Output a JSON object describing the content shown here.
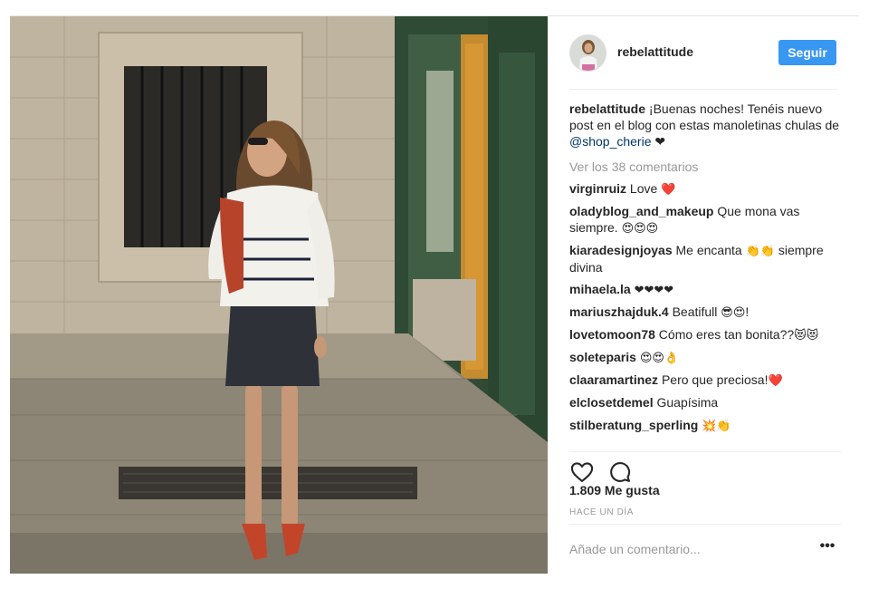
{
  "post": {
    "username": "rebelattitude",
    "follow_label": "Seguir",
    "caption": {
      "username": "rebelattitude",
      "text_before": " ¡Buenas noches! Tenéis nuevo post en el blog con estas manoletinas chulas de ",
      "mention": "@shop_cherie",
      "text_after": " ❤"
    },
    "view_all_label": "Ver los 38 comentarios",
    "comments": [
      {
        "user": "virginruiz",
        "text": " Love ",
        "emoji": "❤️"
      },
      {
        "user": "oladyblog_and_makeup",
        "text": " Que mona vas siempre. ",
        "emoji": "😍😍😍"
      },
      {
        "user": "kiaradesignjoyas",
        "text": " Me encanta ",
        "emoji": "👏👏",
        "text2": " siempre divina"
      },
      {
        "user": "mihaela.la",
        "text": " ",
        "emoji": "❤❤❤❤"
      },
      {
        "user": "mariuszhajduk.4",
        "text": " Beatifull ",
        "emoji": "😎😍",
        "text2": "!"
      },
      {
        "user": "lovetomoon78",
        "text": " Cómo eres tan bonita??",
        "emoji": "😻😻"
      },
      {
        "user": "soleteparis",
        "text": " ",
        "emoji": "😍😍👌"
      },
      {
        "user": "claaramartinez",
        "text": " Pero que preciosa!",
        "emoji": "❤️"
      },
      {
        "user": "elclosetdemel",
        "text": " Guapísima",
        "emoji": ""
      },
      {
        "user": "stilberatung_sperling",
        "text": " ",
        "emoji": "💥👏"
      }
    ],
    "likes": "1.809 Me gusta",
    "time_ago": "HACE UN DÍA",
    "add_comment_placeholder": "Añade un comentario...",
    "more_label": "•••",
    "icons": {
      "like": "heart-outline-icon",
      "comment": "speech-bubble-icon",
      "more": "ellipsis-icon"
    },
    "colors": {
      "accent": "#3897f0",
      "mention": "#003569",
      "muted": "#999999",
      "text": "#262626"
    }
  }
}
